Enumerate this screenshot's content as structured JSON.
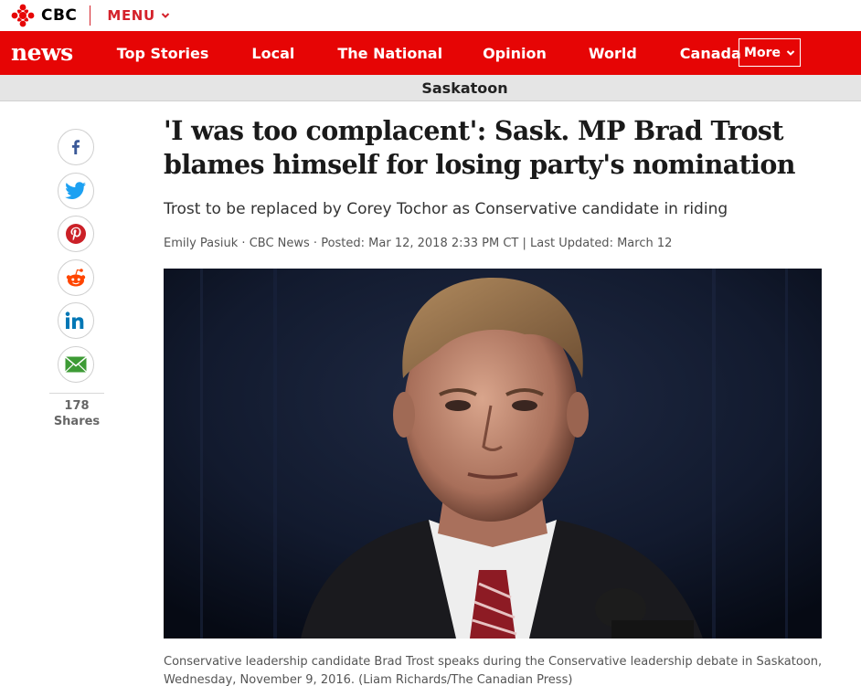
{
  "topbar": {
    "brand_label": "CBC",
    "menu_label": "MENU"
  },
  "nav": {
    "logo_label": "news",
    "items": [
      {
        "label": "Top Stories"
      },
      {
        "label": "Local"
      },
      {
        "label": "The National"
      },
      {
        "label": "Opinion"
      },
      {
        "label": "World"
      },
      {
        "label": "Canada"
      }
    ],
    "more_label": "More"
  },
  "section": {
    "title": "Saskatoon"
  },
  "share": {
    "buttons": [
      {
        "icon": "facebook-icon"
      },
      {
        "icon": "twitter-icon"
      },
      {
        "icon": "pinterest-icon"
      },
      {
        "icon": "reddit-icon"
      },
      {
        "icon": "linkedin-icon"
      },
      {
        "icon": "email-icon"
      }
    ],
    "count": "178",
    "count_label": "Shares"
  },
  "article": {
    "headline": "'I was too complacent': Sask. MP Brad Trost blames himself for losing party's nomination",
    "deck": "Trost to be replaced by Corey Tochor as Conservative candidate in riding",
    "byline": "Emily Pasiuk · CBC News · Posted: Mar 12, 2018 2:33 PM CT | Last Updated: March 12",
    "caption": "Conservative leadership candidate Brad Trost speaks during the Conservative leadership debate in Saskatoon, Wednesday, November 9, 2016. (Liam Richards/The Canadian Press)"
  },
  "colors": {
    "brand_red": "#e60505",
    "section_bg": "#e5e5e5"
  }
}
